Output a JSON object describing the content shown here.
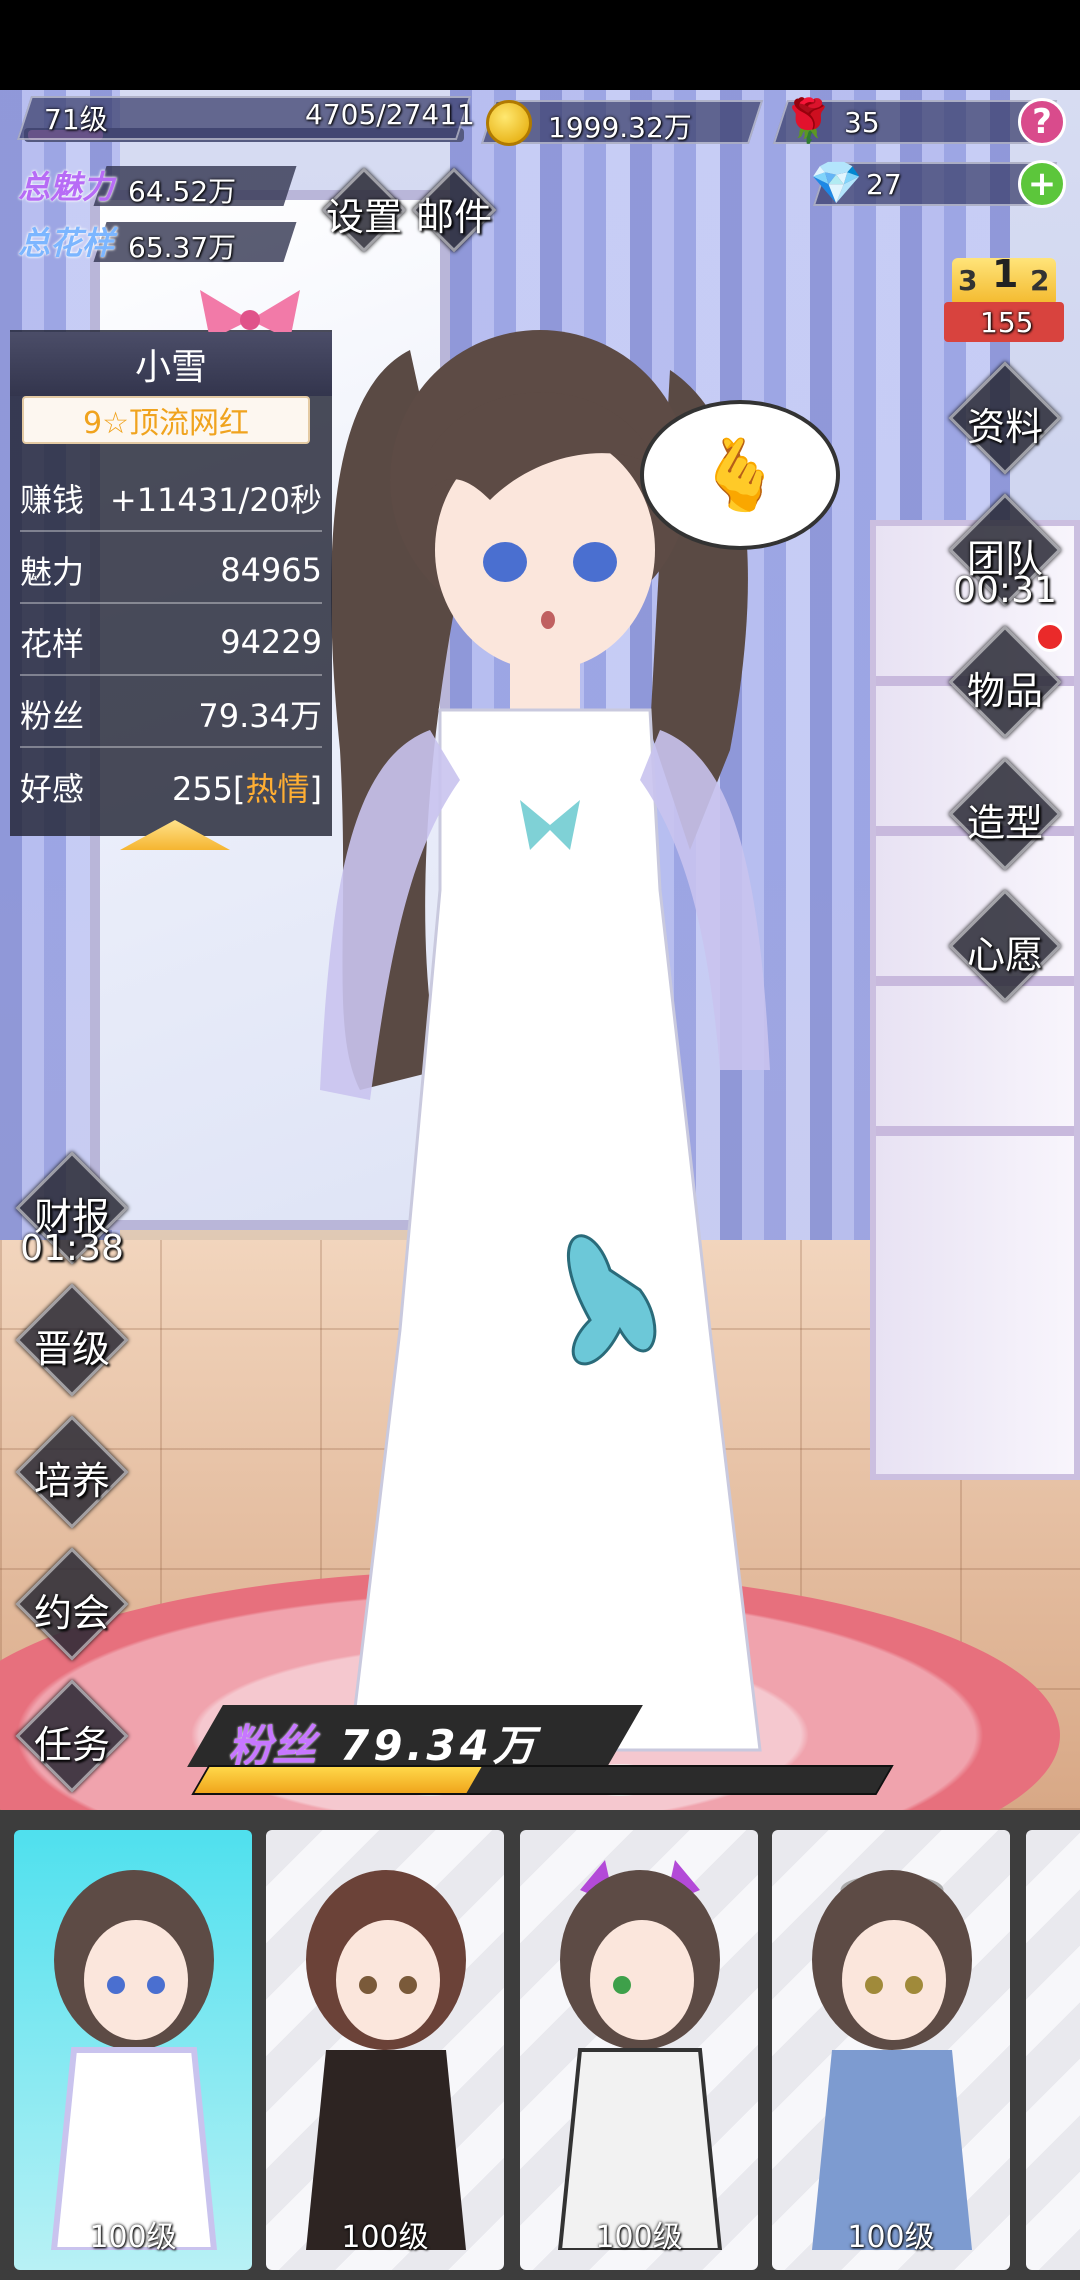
{
  "player": {
    "level": "71级",
    "exp": "4705/27411",
    "exp_fraction": 0.17,
    "coins": "1999.32万",
    "roses": "35",
    "diamonds": "27"
  },
  "totals": {
    "charm_label": "总魅力",
    "charm_value": "64.52万",
    "style_label": "总花样",
    "style_value": "65.37万"
  },
  "top_menu": {
    "settings": "设置",
    "mail": "邮件"
  },
  "rank": {
    "first": "1",
    "second": "2",
    "third": "3",
    "value": "155"
  },
  "right_menu": {
    "profile": "资料",
    "team": "团队",
    "team_timer": "00:31",
    "items": "物品",
    "styling": "造型",
    "wish": "心愿"
  },
  "left_menu": {
    "finance": "财报",
    "finance_timer": "01:38",
    "promote": "晋级",
    "train": "培养",
    "date": "约会",
    "tasks": "任务"
  },
  "character": {
    "name": "小雪",
    "title": "9☆顶流网红",
    "stats": [
      {
        "label": "赚钱",
        "value": "+11431/20秒"
      },
      {
        "label": "魅力",
        "value": "84965"
      },
      {
        "label": "花样",
        "value": "94229"
      },
      {
        "label": "粉丝",
        "value": "79.34万"
      },
      {
        "label": "好感",
        "value": "255",
        "tag_open": "[",
        "tag": "热情",
        "tag_close": "]"
      }
    ]
  },
  "fans": {
    "label": "粉丝",
    "value": "79.34万",
    "progress_fraction": 0.4
  },
  "roster": [
    {
      "level": "100级",
      "selected": true
    },
    {
      "level": "100级",
      "selected": false
    },
    {
      "level": "100级",
      "selected": false
    },
    {
      "level": "100级",
      "selected": false
    }
  ],
  "colors": {
    "charm_purple": "#b76cf6",
    "title_orange": "#f0a31e",
    "hot_orange": "#ffae33",
    "progress_yellow": "#f0a51c",
    "selected_cyan": "#4fe0ee"
  }
}
